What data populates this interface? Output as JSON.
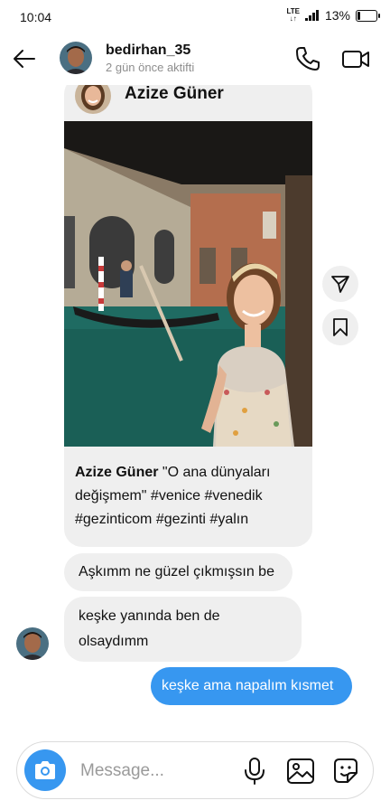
{
  "status_bar": {
    "time": "10:04",
    "network": "LTE",
    "battery_text": "13%",
    "battery_level": 0.13
  },
  "header": {
    "username": "bedirhan_35",
    "activity": "2 gün önce aktifti"
  },
  "shared_post": {
    "author": "Azize Güner",
    "caption_author": "Azize Güner",
    "caption_text": " \"O ana dünyaları değişmem\" #venice #venedik #gezinticom #gezinti #yalın"
  },
  "messages": [
    {
      "sender": "them",
      "text": "Aşkımm ne güzel çıkmışsın be"
    },
    {
      "sender": "them",
      "text": "keşke yanında ben de olsaydımm"
    },
    {
      "sender": "me",
      "text": "keşke ama napalım kısmet"
    }
  ],
  "composer": {
    "placeholder": "Message..."
  },
  "icons": {
    "back": "arrow-left-icon",
    "call": "phone-icon",
    "video": "video-camera-icon",
    "share": "send-icon",
    "save": "bookmark-icon",
    "camera": "camera-icon",
    "mic": "microphone-icon",
    "gallery": "image-icon",
    "sticker": "sticker-icon"
  },
  "colors": {
    "accent": "#3797f0",
    "bubble_gray": "#efefef",
    "muted_text": "#8e8e8e"
  }
}
